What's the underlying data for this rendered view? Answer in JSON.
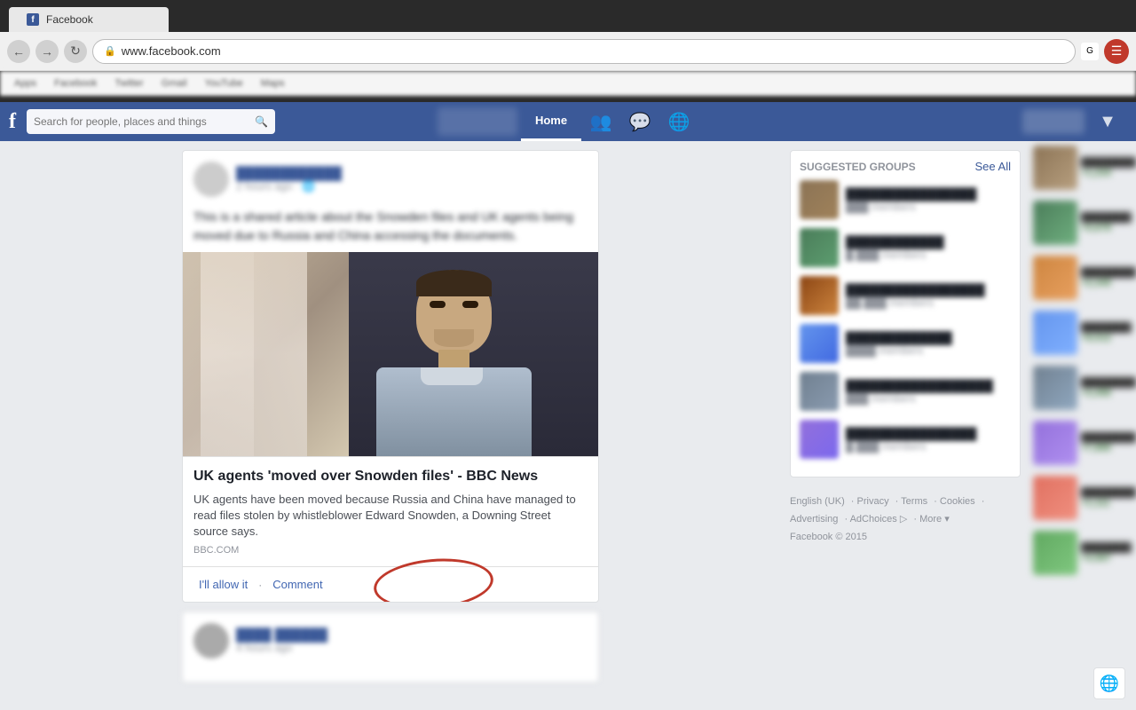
{
  "browser": {
    "tab_label": "Facebook",
    "address": "www.facebook.com",
    "bookmark_items": [
      "Apps",
      "Facebook",
      "Twitter",
      "Gmail",
      "YouTube",
      "Maps"
    ]
  },
  "fb_header": {
    "logo": "f",
    "search_placeholder": "Search for people, places and things",
    "nav_home": "Home",
    "nav_friends_icon": "👥",
    "nav_messages_icon": "💬",
    "nav_globe_icon": "🌐",
    "nav_settings_icon": "⚙"
  },
  "news_article": {
    "title": "UK agents 'moved over Snowden files' - BBC News",
    "description": "UK agents have been moved because Russia and China have managed to read files stolen by whistleblower Edward Snowden, a Downing Street source says.",
    "source": "BBC.COM",
    "action_like": "I'll allow it",
    "action_comment": "Comment"
  },
  "right_sidebar": {
    "suggested_groups_title": "SUGGESTED GROUPS",
    "see_all": "See All",
    "groups": [
      {
        "thumb_class": "group-thumb-1",
        "name": "Group 1",
        "members": "1,234 members"
      },
      {
        "thumb_class": "group-thumb-2",
        "name": "Group 2",
        "members": "5,678 members"
      },
      {
        "thumb_class": "group-thumb-3",
        "name": "Group 3",
        "members": "2,345 members"
      },
      {
        "thumb_class": "group-thumb-4",
        "name": "Group 4",
        "members": "9,012 members"
      },
      {
        "thumb_class": "group-thumb-5",
        "name": "Group 5",
        "members": "3,456 members"
      },
      {
        "thumb_class": "group-thumb-6",
        "name": "Group 6",
        "members": "7,890 members"
      }
    ]
  },
  "footer": {
    "language": "English (UK)",
    "links": [
      "Privacy",
      "Terms",
      "Cookies",
      "Advertising",
      "AdChoices",
      "More"
    ],
    "copyright": "Facebook © 2015"
  },
  "far_right": {
    "items": [
      {
        "thumb": "r1",
        "count": "+1,234"
      },
      {
        "thumb": "r2",
        "count": "+5,678"
      },
      {
        "thumb": "r3",
        "count": "+2,345"
      },
      {
        "thumb": "r4",
        "count": "+9,012"
      },
      {
        "thumb": "r5",
        "count": "+3,456"
      },
      {
        "thumb": "r6",
        "count": "+7,890"
      },
      {
        "thumb": "r7",
        "count": "+1,111"
      },
      {
        "thumb": "r8",
        "count": "+4,567"
      }
    ]
  }
}
